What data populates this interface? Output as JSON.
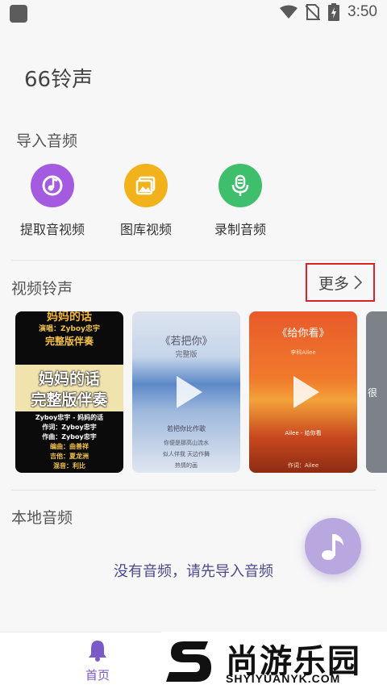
{
  "status_bar": {
    "time": "3:50"
  },
  "app": {
    "title": "66铃声"
  },
  "import_section": {
    "title": "导入音频",
    "items": [
      {
        "label": "提取音视频",
        "icon": "music-disc-icon",
        "color": "#a55be0"
      },
      {
        "label": "图库视频",
        "icon": "gallery-icon",
        "color": "#f2b21b"
      },
      {
        "label": "录制音频",
        "icon": "microphone-icon",
        "color": "#3fbf6b"
      }
    ]
  },
  "video_section": {
    "title": "视频铃声",
    "more_label": "更多",
    "cards": [
      {
        "top_title": "妈妈的话",
        "singer_line": "演唱：Zyboy忠宇",
        "version": "完整版伴奏",
        "banner_line1": "妈妈的话",
        "banner_line2": "完整版伴奏",
        "credits": [
          "Zyboy忠宇 - 妈妈的话",
          "作词：Zyboy忠宇",
          "作曲：Zyboy忠宇",
          "编曲：曲善祥",
          "吉他：夏龙洲",
          "混音：利比"
        ]
      },
      {
        "title": "《若把你》",
        "subtitle": "完整版",
        "caption": "若把你比作歌",
        "lines": [
          "你便是那高山流水",
          "似人伴我 天边作舞",
          "热情的画"
        ]
      },
      {
        "title": "《给你看》",
        "singer": "李科Ailee",
        "song_line": "Ailee - 给你看",
        "credit": "作词：Ailee"
      },
      {
        "text": "很"
      }
    ]
  },
  "local_section": {
    "title": "本地音频",
    "empty_message": "没有音频，请先导入音频"
  },
  "bottom_nav": {
    "home_label": "首页"
  },
  "watermark": {
    "brand": "尚游乐园",
    "url": "SHYIYUANYK.COM"
  }
}
